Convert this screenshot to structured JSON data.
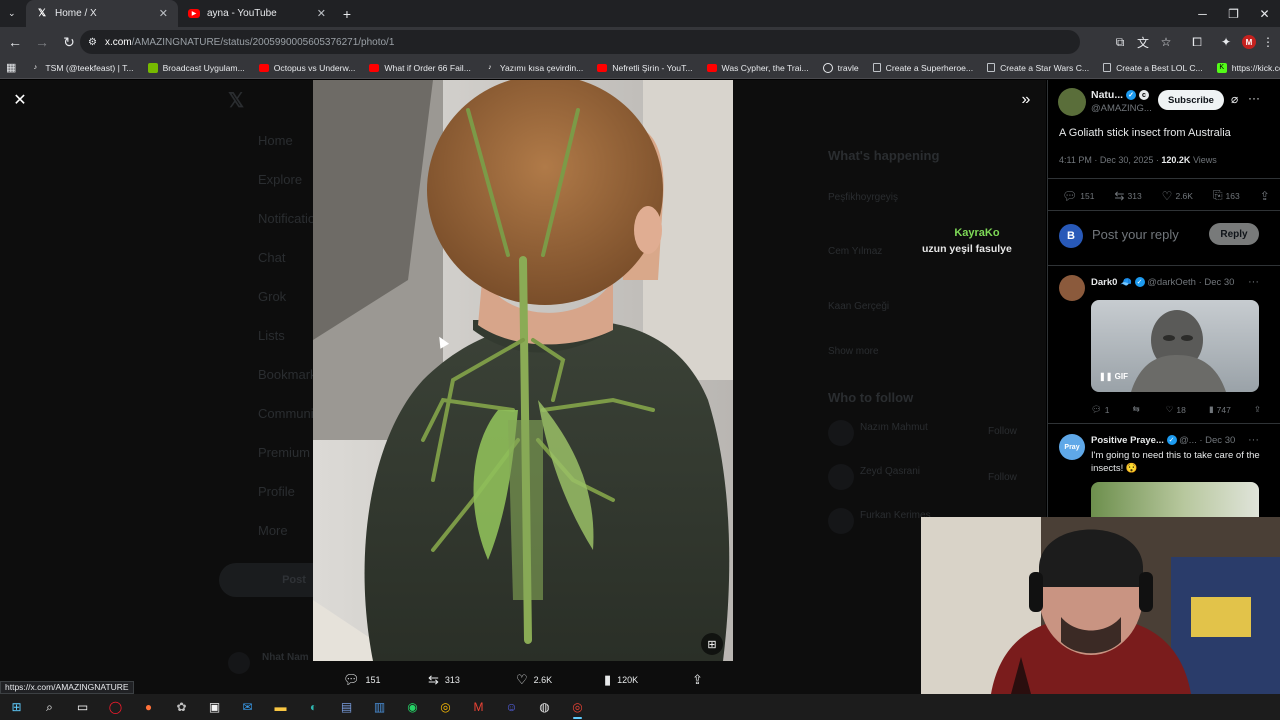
{
  "browser": {
    "tabs": [
      {
        "title": "Home / X",
        "icon": "x-logo-icon",
        "active": true
      },
      {
        "title": "ayna - YouTube",
        "icon": "youtube-icon",
        "active": false
      }
    ],
    "new_tab": "+",
    "url_domain": "x.com",
    "url_path": "/AMAZINGNATURE/status/2005990005605376271/photo/1",
    "profile_initial": "M",
    "bookmarks": [
      {
        "label": "TSM (@teekfeast) | T...",
        "icon": "tiktok-icon"
      },
      {
        "label": "Broadcast Uygulam...",
        "icon": "nvidia-icon"
      },
      {
        "label": "Octopus vs Underw...",
        "icon": "youtube-icon"
      },
      {
        "label": "What if Order 66 Fail...",
        "icon": "youtube-icon"
      },
      {
        "label": "Yazımı kısa çevirdin...",
        "icon": "tiktok-icon"
      },
      {
        "label": "Nefretli Şirin - YouT...",
        "icon": "youtube-icon"
      },
      {
        "label": "Was Cypher, the Trai...",
        "icon": "youtube-icon"
      },
      {
        "label": "travle",
        "icon": "globe-icon"
      },
      {
        "label": "Create a Superheroe...",
        "icon": "doc-icon"
      },
      {
        "label": "Create a Star Wars C...",
        "icon": "doc-icon"
      },
      {
        "label": "Create a Best LOL C...",
        "icon": "doc-icon"
      },
      {
        "label": "https://kick.com/m...",
        "icon": "kick-icon"
      }
    ]
  },
  "background_feed": {
    "nav": [
      "Home",
      "Explore",
      "Notifications",
      "Chat",
      "Grok",
      "Lists",
      "Bookmarks",
      "Communities",
      "Premium",
      "Profile",
      "More"
    ],
    "post_button": "Post",
    "trends_title": "What's happening",
    "trends": [
      "Peşfikhoyrgeyiş",
      "Cem Yılmaz",
      "Kaan Gerçeği",
      "Show more"
    ],
    "who_to_follow": "Who to follow",
    "follow_names": [
      "Nazım Mahmut",
      "Zeyd Qasrani",
      "Furkan Kerimes"
    ],
    "follow_label": "Follow",
    "bottom_user": "Nhat Nam"
  },
  "viewer": {
    "close_icon": "close-icon",
    "expand_icon": "expand-icon",
    "photo_alt": "Goliath stick insect on child's back",
    "actions": {
      "replies": "151",
      "reposts": "313",
      "likes": "2.6K",
      "views": "120K"
    }
  },
  "overlay": {
    "name": "KayraKo",
    "message": "uzun yeşil fasulye"
  },
  "post": {
    "author_name": "Natu...",
    "author_handle": "@AMAZING...",
    "subscribe_label": "Subscribe",
    "text": "A Goliath stick insect from Australia",
    "time": "4:11 PM · Dec 30, 2025 ·",
    "views_count": "120.2K",
    "views_label": "Views",
    "replies": "151",
    "reposts": "313",
    "likes": "2.6K",
    "bookmarks": "163",
    "reply_placeholder": "Post your reply",
    "reply_button": "Reply",
    "user_avatar_initial": "B"
  },
  "replies": [
    {
      "name": "Dark0",
      "handle": "@darkOeth",
      "date": "· Dec 30",
      "gif_label": "GIF",
      "replies": "1",
      "reposts": "",
      "likes": "18",
      "views": "747"
    },
    {
      "name": "Positive Praye...",
      "handle": "@...",
      "date": "· Dec 30",
      "avatar_text": "Pray",
      "text": "I'm going to need this to take care of the insects!"
    }
  ],
  "status_link": "https://x.com/AMAZINGNATURE",
  "colors": {
    "x_blue": "#1d9bf0",
    "overlay_name": "#7ed957",
    "chrome_bg": "#35363a"
  }
}
